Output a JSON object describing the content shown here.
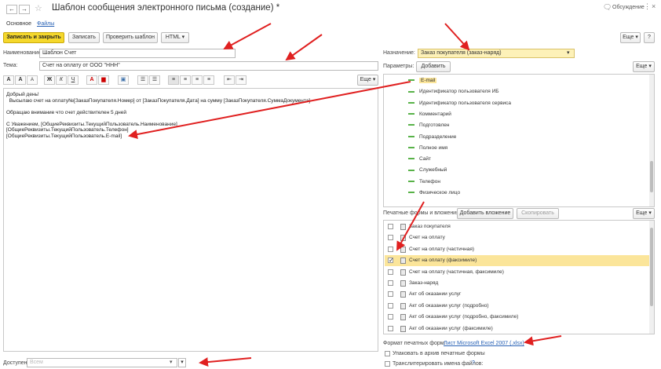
{
  "window": {
    "title": "Шаблон сообщения электронного письма (создание) *",
    "discussion_label": "Обсуждение"
  },
  "tabs": [
    "Основное",
    "Файлы"
  ],
  "toolbar": {
    "save_close": "Записать и закрыть",
    "save": "Записать",
    "check": "Проверить шаблон",
    "html": "HTML",
    "more": "Еще"
  },
  "fields": {
    "name_label": "Наименование:",
    "name_value": "Шаблон Счет",
    "subject_label": "Тема:",
    "subject_value": "Счет на оплату от ООО \"ННН\"",
    "purpose_label": "Назначение:",
    "purpose_value": "Заказ покупателя (заказ-наряд)",
    "params_label": "Параметры:",
    "add_button": "Добавить",
    "available_label": "Доступен:",
    "available_placeholder": "Всем"
  },
  "format_buttons": [
    "A",
    "A",
    "A",
    "Ж",
    "К",
    "Ч"
  ],
  "format_more": "Еще",
  "editor_lines": [
    "Добрый день!",
    "  Высылаю счет на оплату№[ЗаказПокупателя.Номер] от [ЗаказПокупателя.Дата] на сумму [ЗаказПокупателя.СуммаДокумента]",
    "",
    "Обращаю внимание что счет действителен 5 дней",
    "",
    "С Уважением, [ОбщиеРеквизиты.ТекущийПользователь.Наименование]",
    "[ОбщиеРеквизиты.ТекущийПользователь.Телефон]",
    "[ОбщиеРеквизиты.ТекущийПользователь.E-mail]"
  ],
  "params_more": "Еще",
  "params": [
    "E-mail",
    "Идентификатор пользователя ИБ",
    "Идентификатор пользователя сервиса",
    "Комментарий",
    "Подготовлен",
    "Подразделение",
    "Полное имя",
    "Сайт",
    "Служебный",
    "Телефон",
    "Физическое лицо"
  ],
  "print_forms": {
    "label": "Печатные формы и вложения:",
    "add_attachment": "Добавить вложение",
    "copy": "Скопировать",
    "more": "Еще",
    "items": [
      {
        "name": "Заказ покупателя",
        "checked": false
      },
      {
        "name": "Счет на оплату",
        "checked": false
      },
      {
        "name": "Счет на оплату (частичная)",
        "checked": false
      },
      {
        "name": "Счет на оплату (факсимиле)",
        "checked": true
      },
      {
        "name": "Счет на оплату (частичная, факсимиле)",
        "checked": false
      },
      {
        "name": "Заказ-наряд",
        "checked": false
      },
      {
        "name": "Акт об оказании услуг",
        "checked": false
      },
      {
        "name": "Акт об оказании услуг (подробно)",
        "checked": false
      },
      {
        "name": "Акт об оказании услуг (подробно, факсимиле)",
        "checked": false
      },
      {
        "name": "Акт об оказании услуг (факсимиле)",
        "checked": false
      }
    ]
  },
  "format": {
    "label": "Формат печатных форм:",
    "value": "Лист Microsoft Excel 2007 (.xlsx)"
  },
  "options": {
    "archive": "Упаковать в архив печатные формы",
    "transliterate": "Транслитерировать имена файлов:",
    "help": "?"
  },
  "colors": {
    "accent_yellow": "#f5d82c",
    "selected_row": "#fbe59a",
    "annotation_red": "#e02020",
    "param_green": "#58b248"
  }
}
